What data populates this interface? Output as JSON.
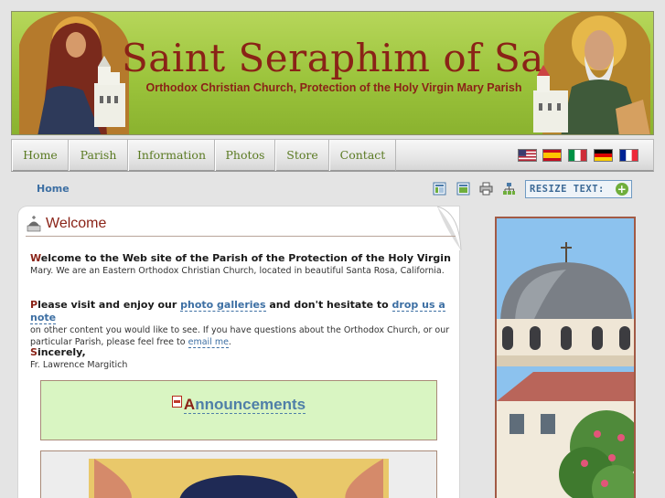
{
  "banner": {
    "title": "Saint Seraphim of Sarov",
    "subtitle": "Orthodox Christian Church, Protection of the Holy Virgin Mary Parish"
  },
  "nav": {
    "items": [
      "Home",
      "Parish",
      "Information",
      "Photos",
      "Store",
      "Contact"
    ]
  },
  "flags": [
    "us-flag-icon",
    "es-flag-icon",
    "it-flag-icon",
    "de-flag-icon",
    "fr-flag-icon"
  ],
  "breadcrumb": {
    "home": "Home"
  },
  "toolbar": {
    "icons": [
      "layout-narrow-icon",
      "layout-wide-icon",
      "print-icon",
      "sitemap-icon"
    ],
    "resize_label": "RESIZE TEXT:",
    "resize_plus": "+"
  },
  "welcome": {
    "heading": "Welcome",
    "p1_cap": "W",
    "p1_lead": "elcome to the Web site of the Parish of the Protection of the Holy Virgin",
    "p1_rest": "Mary. We are an Eastern Orthodox Christian Church, located in beautiful Santa Rosa, California.",
    "p2_cap": "P",
    "p2_lead_a": "lease visit and enjoy our ",
    "p2_link1": "photo galleries",
    "p2_lead_b": " and don't hesitate to ",
    "p2_link2": "drop us a note",
    "p2_rest": "on other content you would like to see. If you have questions about the Orthodox Church, or our particular Parish, please feel free to ",
    "p2_link3": "email me",
    "p2_end": ".",
    "sign_cap": "S",
    "sign_lead": "incerely,",
    "sign_name": "Fr. Lawrence Margitich"
  },
  "announcements": {
    "cap": "A",
    "rest": "nnouncements"
  },
  "colors": {
    "accent_red": "#8a2317",
    "link_blue": "#3d6fa3",
    "nav_green": "#5a7a22",
    "banner_green": "#9cc43c"
  }
}
